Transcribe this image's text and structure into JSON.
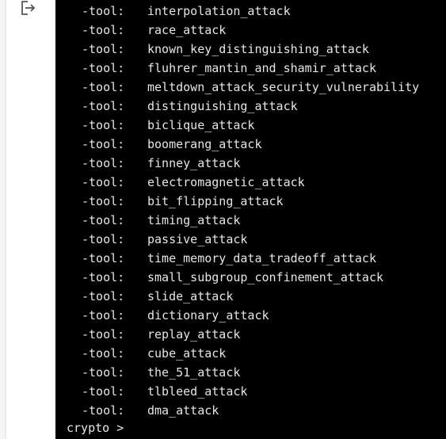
{
  "gutter": {
    "icon": "output-redirect-icon"
  },
  "terminal": {
    "entries": [
      {
        "key": "-tool:",
        "value": "interpolation_attack"
      },
      {
        "key": "-tool:",
        "value": "race_attack"
      },
      {
        "key": "-tool:",
        "value": "known_key_distinguishing_attack"
      },
      {
        "key": "-tool:",
        "value": "fluhrer_mantin_and_shamir_attack"
      },
      {
        "key": "-tool:",
        "value": "meltdown_attack_security_vulnerability"
      },
      {
        "key": "-tool:",
        "value": "distinguishing_attack"
      },
      {
        "key": "-tool:",
        "value": "biclique_attack"
      },
      {
        "key": "-tool:",
        "value": "boomerang_attack"
      },
      {
        "key": "-tool:",
        "value": "finney_attack"
      },
      {
        "key": "-tool:",
        "value": "electromagnetic_attack"
      },
      {
        "key": "-tool:",
        "value": "bit_flipping_attack"
      },
      {
        "key": "-tool:",
        "value": "timing_attack"
      },
      {
        "key": "-tool:",
        "value": "passive_attack"
      },
      {
        "key": "-tool:",
        "value": "time_memory_data_tradeoff_attack"
      },
      {
        "key": "-tool:",
        "value": "small_subgroup_confinement_attack"
      },
      {
        "key": "-tool:",
        "value": "slide_attack"
      },
      {
        "key": "-tool:",
        "value": "dictionary_attack"
      },
      {
        "key": "-tool:",
        "value": "replay_attack"
      },
      {
        "key": "-tool:",
        "value": "cube_attack"
      },
      {
        "key": "-tool:",
        "value": "the_51_attack"
      },
      {
        "key": "-tool:",
        "value": "tlbleed_attack"
      },
      {
        "key": "-tool:",
        "value": "dma_attack"
      }
    ],
    "prompt": "crypto > "
  },
  "colors": {
    "terminal_bg": "#000000",
    "terminal_text": "#e6e6e6",
    "page_bg": "#ffffff"
  }
}
